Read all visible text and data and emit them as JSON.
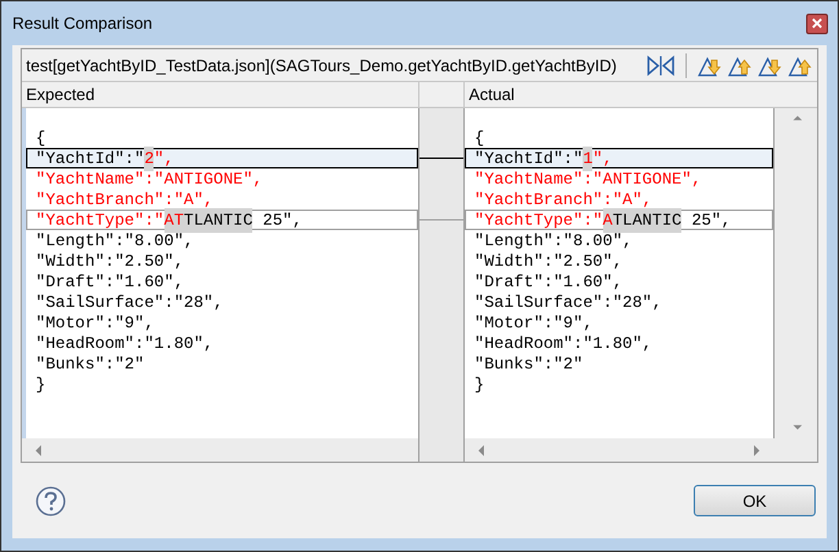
{
  "window": {
    "title": "Result Comparison"
  },
  "toolbar": {
    "label": "test[getYachtByID_TestData.json](SAGTours_Demo.getYachtByID.getYachtByID)"
  },
  "panes": [
    {
      "heading": "Expected",
      "lines": [
        {
          "selected": false,
          "outlined": false,
          "segments": [
            {
              "text": "{",
              "changed": false,
              "shaded": false
            }
          ]
        },
        {
          "selected": true,
          "outlined": false,
          "segments": [
            {
              "text": "\"YachtId\":\"",
              "changed": false,
              "shaded": false
            },
            {
              "text": "2",
              "changed": true,
              "shaded": true
            },
            {
              "text": "\",",
              "changed": true,
              "shaded": false
            }
          ]
        },
        {
          "selected": false,
          "outlined": false,
          "segments": [
            {
              "text": "\"YachtName\":\"ANTIGONE\",",
              "changed": true,
              "shaded": false
            }
          ]
        },
        {
          "selected": false,
          "outlined": false,
          "segments": [
            {
              "text": "\"YachtBranch\":\"A\",",
              "changed": true,
              "shaded": false
            }
          ]
        },
        {
          "selected": false,
          "outlined": true,
          "segments": [
            {
              "text": "\"YachtType\":\"",
              "changed": true,
              "shaded": false
            },
            {
              "text": "AT",
              "changed": true,
              "shaded": true
            },
            {
              "text": "TLANTIC",
              "changed": false,
              "shaded": true
            },
            {
              "text": " 25\",",
              "changed": false,
              "shaded": false
            }
          ]
        },
        {
          "selected": false,
          "outlined": false,
          "segments": [
            {
              "text": "\"Length\":\"8.00\",",
              "changed": false,
              "shaded": false
            }
          ]
        },
        {
          "selected": false,
          "outlined": false,
          "segments": [
            {
              "text": "\"Width\":\"2.50\",",
              "changed": false,
              "shaded": false
            }
          ]
        },
        {
          "selected": false,
          "outlined": false,
          "segments": [
            {
              "text": "\"Draft\":\"1.60\",",
              "changed": false,
              "shaded": false
            }
          ]
        },
        {
          "selected": false,
          "outlined": false,
          "segments": [
            {
              "text": "\"SailSurface\":\"28\",",
              "changed": false,
              "shaded": false
            }
          ]
        },
        {
          "selected": false,
          "outlined": false,
          "segments": [
            {
              "text": "\"Motor\":\"9\",",
              "changed": false,
              "shaded": false
            }
          ]
        },
        {
          "selected": false,
          "outlined": false,
          "segments": [
            {
              "text": "\"HeadRoom\":\"1.80\",",
              "changed": false,
              "shaded": false
            }
          ]
        },
        {
          "selected": false,
          "outlined": false,
          "segments": [
            {
              "text": "\"Bunks\":\"2\"",
              "changed": false,
              "shaded": false
            }
          ]
        },
        {
          "selected": false,
          "outlined": false,
          "segments": [
            {
              "text": "}",
              "changed": false,
              "shaded": false
            }
          ]
        }
      ]
    },
    {
      "heading": "Actual",
      "lines": [
        {
          "selected": false,
          "outlined": false,
          "segments": [
            {
              "text": "{",
              "changed": false,
              "shaded": false
            }
          ]
        },
        {
          "selected": true,
          "outlined": false,
          "segments": [
            {
              "text": "\"YachtId\":\"",
              "changed": false,
              "shaded": false
            },
            {
              "text": "1",
              "changed": true,
              "shaded": true
            },
            {
              "text": "\",",
              "changed": true,
              "shaded": false
            }
          ]
        },
        {
          "selected": false,
          "outlined": false,
          "segments": [
            {
              "text": "\"YachtName\":\"ANTIGONE\",",
              "changed": true,
              "shaded": false
            }
          ]
        },
        {
          "selected": false,
          "outlined": false,
          "segments": [
            {
              "text": "\"YachtBranch\":\"A\",",
              "changed": true,
              "shaded": false
            }
          ]
        },
        {
          "selected": false,
          "outlined": true,
          "segments": [
            {
              "text": "\"YachtType\":\"",
              "changed": true,
              "shaded": false
            },
            {
              "text": "A",
              "changed": true,
              "shaded": true
            },
            {
              "text": "TLANTIC",
              "changed": false,
              "shaded": true
            },
            {
              "text": " 25\",",
              "changed": false,
              "shaded": false
            }
          ]
        },
        {
          "selected": false,
          "outlined": false,
          "segments": [
            {
              "text": "\"Length\":\"8.00\",",
              "changed": false,
              "shaded": false
            }
          ]
        },
        {
          "selected": false,
          "outlined": false,
          "segments": [
            {
              "text": "\"Width\":\"2.50\",",
              "changed": false,
              "shaded": false
            }
          ]
        },
        {
          "selected": false,
          "outlined": false,
          "segments": [
            {
              "text": "\"Draft\":\"1.60\",",
              "changed": false,
              "shaded": false
            }
          ]
        },
        {
          "selected": false,
          "outlined": false,
          "segments": [
            {
              "text": "\"SailSurface\":\"28\",",
              "changed": false,
              "shaded": false
            }
          ]
        },
        {
          "selected": false,
          "outlined": false,
          "segments": [
            {
              "text": "\"Motor\":\"9\",",
              "changed": false,
              "shaded": false
            }
          ]
        },
        {
          "selected": false,
          "outlined": false,
          "segments": [
            {
              "text": "\"HeadRoom\":\"1.80\",",
              "changed": false,
              "shaded": false
            }
          ]
        },
        {
          "selected": false,
          "outlined": false,
          "segments": [
            {
              "text": "\"Bunks\":\"2\"",
              "changed": false,
              "shaded": false
            }
          ]
        },
        {
          "selected": false,
          "outlined": false,
          "segments": [
            {
              "text": "}",
              "changed": false,
              "shaded": false
            }
          ]
        }
      ]
    }
  ],
  "buttons": {
    "ok": "OK"
  }
}
